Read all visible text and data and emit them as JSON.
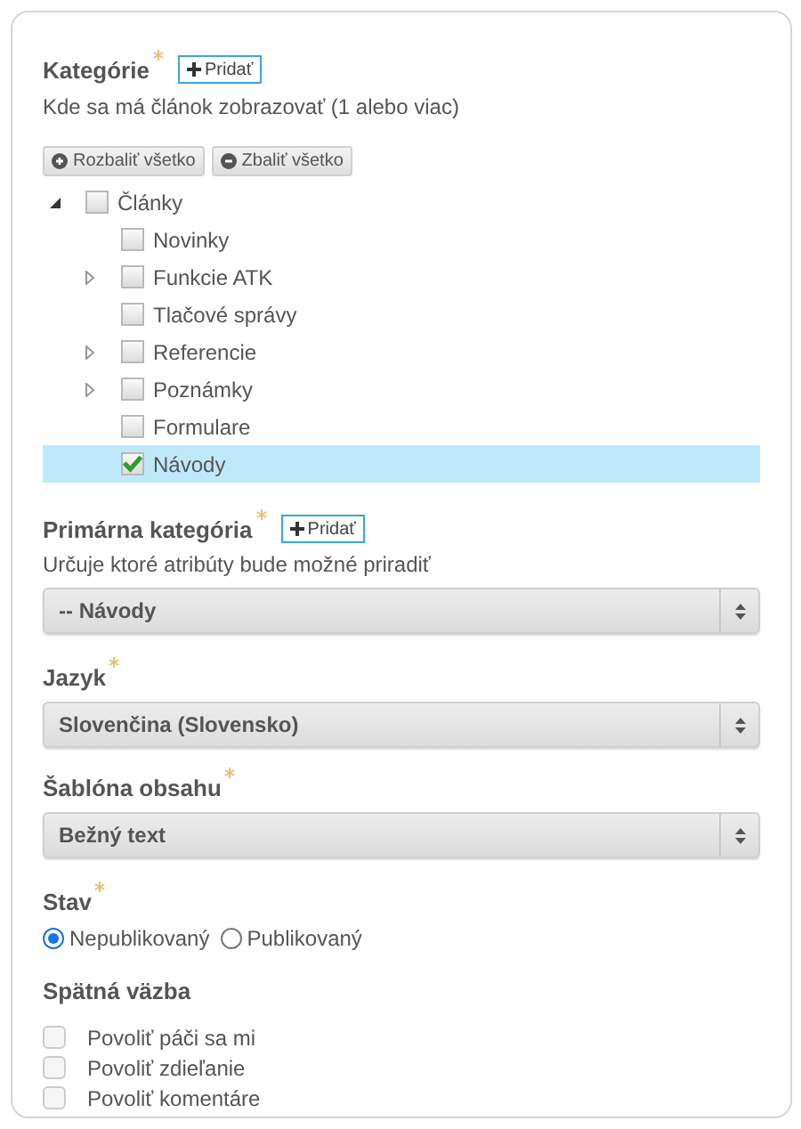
{
  "categories": {
    "label": "Kategórie",
    "required": true,
    "add_button": "Pridať",
    "description": "Kde sa má článok zobrazovať (1 alebo viac)",
    "tools": [
      {
        "kind": "expand",
        "label": "Rozbaliť všetko"
      },
      {
        "kind": "collapse",
        "label": "Zbaliť všetko"
      }
    ],
    "tree": [
      {
        "label": "Články",
        "kind": "branch",
        "expanded": true,
        "checked": false,
        "selected": false,
        "children": [
          {
            "label": "Novinky",
            "kind": "leaf",
            "checked": false,
            "selected": false
          },
          {
            "label": "Funkcie ATK",
            "kind": "branch",
            "expanded": false,
            "checked": false,
            "selected": false
          },
          {
            "label": "Tlačové správy",
            "kind": "leaf",
            "checked": false,
            "selected": false
          },
          {
            "label": "Referencie",
            "kind": "branch",
            "expanded": false,
            "checked": false,
            "selected": false
          },
          {
            "label": "Poznámky",
            "kind": "branch",
            "expanded": false,
            "checked": false,
            "selected": false
          },
          {
            "label": "Formulare",
            "kind": "leaf",
            "checked": false,
            "selected": false
          },
          {
            "label": "Návody",
            "kind": "leaf",
            "checked": true,
            "selected": true
          }
        ]
      }
    ]
  },
  "primary_category": {
    "label": "Primárna kategória",
    "required": true,
    "add_button": "Pridať",
    "description": "Určuje ktoré atribúty bude možné priradiť",
    "value": "-- Návody"
  },
  "language": {
    "label": "Jazyk",
    "required": true,
    "value": "Slovenčina (Slovensko)"
  },
  "template": {
    "label": "Šablóna obsahu",
    "required": true,
    "value": "Bežný text"
  },
  "status": {
    "label": "Stav",
    "required": true,
    "options": [
      {
        "label": "Nepublikovaný",
        "selected": true
      },
      {
        "label": "Publikovaný",
        "selected": false
      }
    ]
  },
  "feedback": {
    "label": "Spätná väzba",
    "options": [
      {
        "label": "Povoliť páči sa mi",
        "checked": false
      },
      {
        "label": "Povoliť zdieľanie",
        "checked": false
      },
      {
        "label": "Povoliť komentáre",
        "checked": false
      }
    ]
  }
}
